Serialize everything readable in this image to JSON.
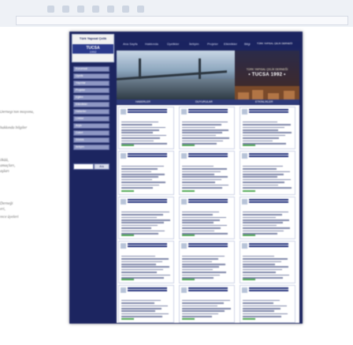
{
  "browser": {
    "nav_icons": [
      "back-icon",
      "forward-icon",
      "reload-icon",
      "stop-icon",
      "home-icon",
      "bookmark-icon",
      "print-icon"
    ]
  },
  "left_column": {
    "lines": [
      "Derneği'nin misyonu,",
      "hakkında bilgiler",
      "öküü,",
      "amaçları,",
      "aşları",
      "Derneği",
      "eri,",
      "rece üyeleri"
    ]
  },
  "site": {
    "logo": {
      "top_text": "Türk Yapısal Çelik",
      "abbr": "TUCSA",
      "year": "1992"
    },
    "nav_items": [
      "Ana Sayfa",
      "Hakkında",
      "Üyelikler",
      "İletişim",
      "Projeler",
      "Etkinlikler",
      "Bilgi",
      "TÜRK YAPISAL ÇELİK DERNEĞİ"
    ],
    "banner": {
      "org_line": "TÜRK YAPISAL ÇELİK DERNEĞİ",
      "abbr_line": "• TUCSA 1992 •"
    },
    "tabs": [
      "HABERLER",
      "DUYURULAR",
      "ETKİNLİKLER"
    ],
    "sidebar_items": [
      "Kurumsal",
      "Üyelik",
      "Yayınlar",
      "Projeler",
      "Eğitim",
      "Etkinlikler",
      "Haberler",
      "Linkler",
      "Arşiv",
      "Galeri",
      "Sözlük",
      "İletişim"
    ],
    "search_button": "Ara"
  },
  "colors": {
    "navy": "#1c2560",
    "tab_blue": "#2e3a7a",
    "link_green": "#4ea852",
    "sidebar_item": "#8f98c4"
  }
}
